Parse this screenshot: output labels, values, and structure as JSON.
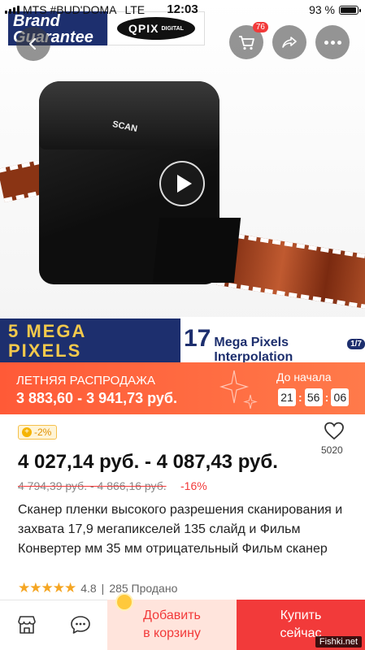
{
  "status_bar": {
    "carrier": "MTS #BUD'DOMA",
    "network": "LTE",
    "time": "12:03",
    "battery": "93 %",
    "battery_level": 0.93
  },
  "hero": {
    "brand_line1": "Brand",
    "brand_line2": "Guarantee",
    "logo_text": "QPIX",
    "logo_sub": "DIGITAL",
    "cart_count": "76",
    "device_label": "SCAN",
    "banner_left_line1": "5 MEGA",
    "banner_left_line2": "PIXELS HARDWARE",
    "banner_right_number": "17",
    "banner_right_text": "Mega Pixels Interpolation",
    "banner_right_pill": "1/7"
  },
  "sale": {
    "title": "ЛЕТНЯЯ РАСПРОДАЖА",
    "price_range": "3 883,60 - 3 941,73 руб.",
    "countdown_label": "До начала",
    "hours": "21",
    "minutes": "56",
    "seconds": "06"
  },
  "product": {
    "coupon": "-2%",
    "wishlist_count": "5020",
    "price": "4 027,14 руб. - 4 087,43 руб.",
    "old_price": "4 794,39 руб. - 4 866,16 руб.",
    "discount": "-16%",
    "title": "Сканер пленки высокого разрешения сканирования и захвата 17,9 мегапикселей 135 слайд и Фильм Конвертер мм 35 мм отрицательный Фильм сканер",
    "stars": "★★★★★",
    "rating": "4.8",
    "sold": "285 Продано"
  },
  "actions": {
    "add_to_cart_line1": "Добавить",
    "add_to_cart_line2": "в корзину",
    "buy_line1": "Купить",
    "buy_line2": "сейчас"
  },
  "watermark": "Fishki.net",
  "colors": {
    "accent": "#f23a3a",
    "sale_orange": "#ff5a37",
    "brand_navy": "#1d2f6e",
    "star": "#f5a623"
  }
}
